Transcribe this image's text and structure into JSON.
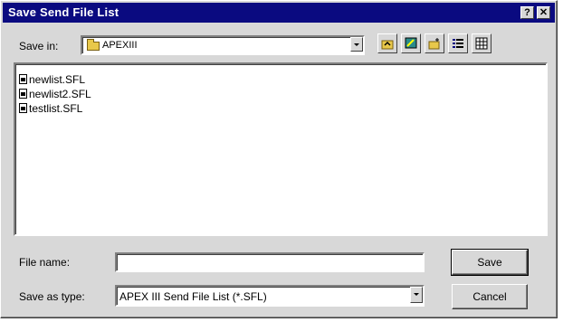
{
  "window": {
    "title": "Save Send File List",
    "help_glyph": "?",
    "close_glyph": "✕"
  },
  "save_in": {
    "label": "Save in:",
    "value": "APEXIII",
    "icon": "folder-icon"
  },
  "toolbar": {
    "icons": [
      "up-folder-icon",
      "desktop-icon",
      "new-folder-icon",
      "list-view-icon",
      "details-view-icon"
    ]
  },
  "files": [
    {
      "name": "newlist.SFL",
      "icon": "file-icon"
    },
    {
      "name": "newlist2.SFL",
      "icon": "file-icon"
    },
    {
      "name": "testlist.SFL",
      "icon": "file-icon"
    }
  ],
  "file_name": {
    "label": "File name:",
    "value": ""
  },
  "save_as_type": {
    "label": "Save as type:",
    "value": "APEX III Send File List (*.SFL)"
  },
  "buttons": {
    "save": "Save",
    "cancel": "Cancel"
  },
  "colors": {
    "titlebar": "#0a0a80",
    "dialog_face": "#d8d8d8"
  }
}
